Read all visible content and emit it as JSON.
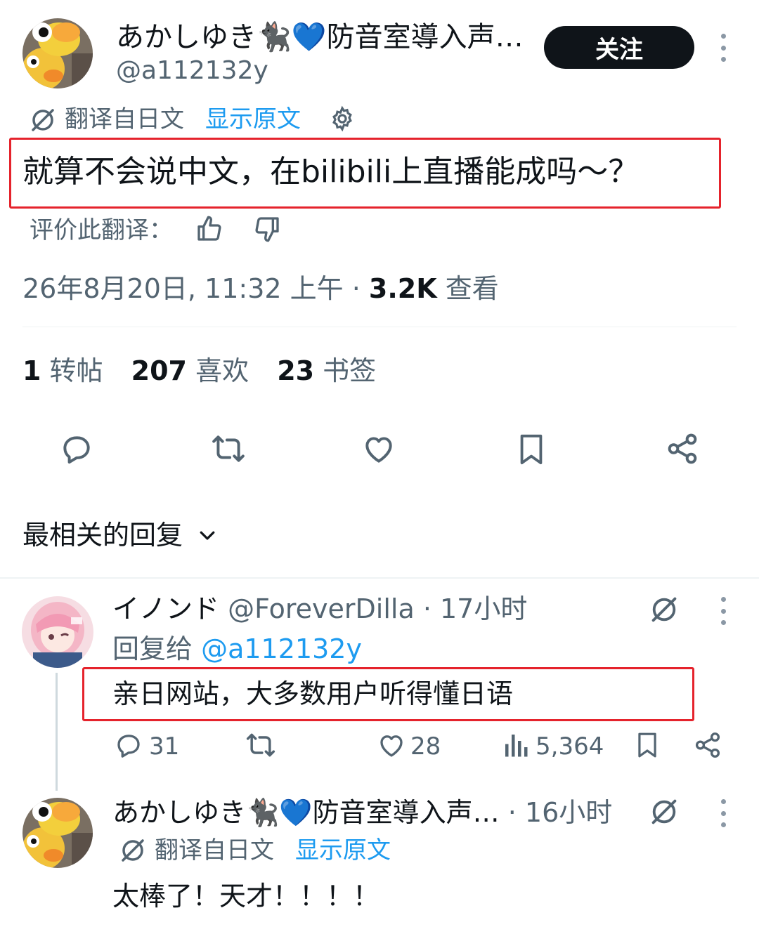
{
  "post": {
    "display_name": "あかしゆき🐈‍⬛💙防音室導入声…",
    "handle": "@a112132y",
    "follow_label": "关注",
    "translated_from": "翻译自日文",
    "show_original": "显示原文",
    "text": "就算不会说中文，在bilibili上直播能成吗～？",
    "rate_translation": "评价此翻译：",
    "date": "26年8月20日, 11:32 上午 · ",
    "views_count": "3.2K",
    "views_label": " 查看",
    "reposts_count": "1",
    "reposts_label": "转帖",
    "likes_count": "207",
    "likes_label": "喜欢",
    "bookmarks_count": "23",
    "bookmarks_label": "书签"
  },
  "replies_sort": "最相关的回复",
  "replies": [
    {
      "display_name": "イノンド",
      "handle": "@ForeverDilla",
      "time": "· 17小时",
      "reply_to_label": "回复给 ",
      "reply_to_handle": "@a112132y",
      "text": "亲日网站，大多数用户听得懂日语",
      "replies": "31",
      "likes": "28",
      "views": "5,364"
    },
    {
      "display_name": "あかしゆき🐈‍⬛💙防音室導入声…",
      "time": "· 16小时",
      "translated_from": "翻译自日文",
      "show_original": "显示原文",
      "text": "太棒了！天才！！！！"
    }
  ],
  "colors": {
    "accent": "#1d9bf0",
    "highlight_box": "#e5232c",
    "follow_button": "#0f1419",
    "muted": "#536471"
  },
  "icons": [
    "translate-icon",
    "gear-icon",
    "thumbs-up-icon",
    "thumbs-down-icon",
    "reply-icon",
    "repost-icon",
    "like-icon",
    "bookmark-icon",
    "share-icon",
    "chevron-down-icon",
    "analytics-icon",
    "more-icon"
  ]
}
